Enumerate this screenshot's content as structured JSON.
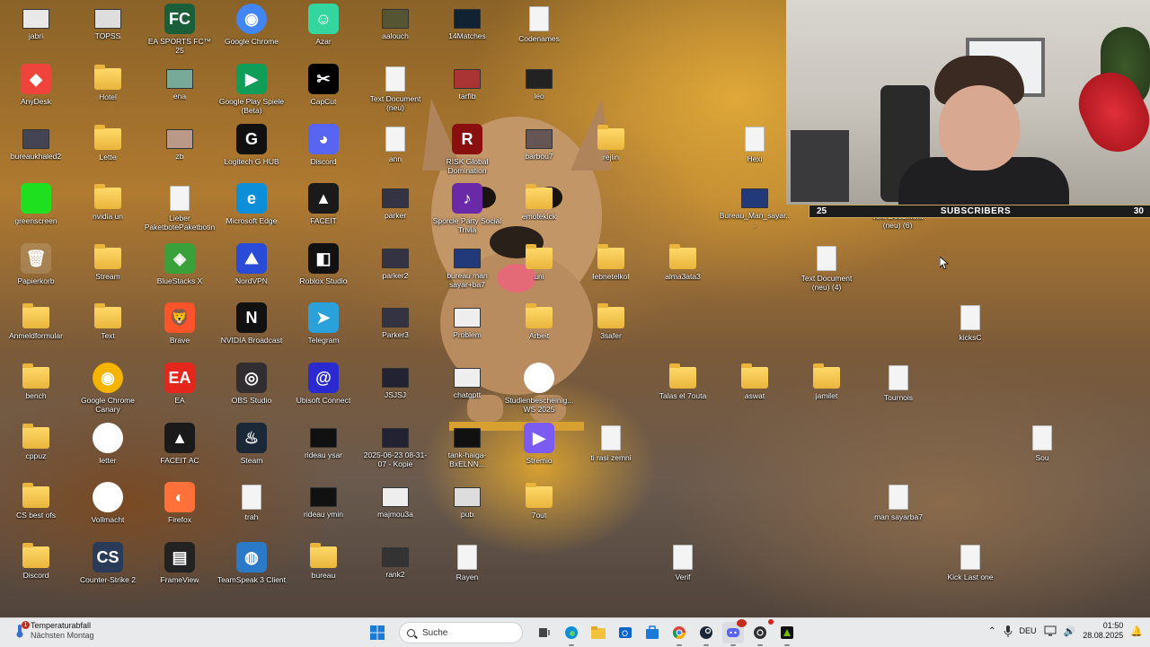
{
  "desktop": {
    "icons": [
      {
        "label": "jabri",
        "type": "thumb",
        "color": "#e8e8e8"
      },
      {
        "label": "TOPSS",
        "type": "thumb",
        "color": "#ddd"
      },
      {
        "label": "EA SPORTS FC™ 25",
        "type": "app",
        "color": "#1b5e3a",
        "glyph": "FC"
      },
      {
        "label": "Google Chrome",
        "type": "app",
        "color": "#4285f4",
        "glyph": "◉"
      },
      {
        "label": "Azar",
        "type": "app",
        "color": "#33d69f",
        "glyph": "☺"
      },
      {
        "label": "aalouch",
        "type": "thumb",
        "color": "#553"
      },
      {
        "label": "14Matches",
        "type": "thumb",
        "color": "#123"
      },
      {
        "label": "Codenames",
        "type": "doc"
      },
      {
        "label": "AnyDesk",
        "type": "app",
        "color": "#ef443b",
        "glyph": "◆"
      },
      {
        "label": "Hotel",
        "type": "folder"
      },
      {
        "label": "ena",
        "type": "thumb",
        "color": "#7a9"
      },
      {
        "label": "Google Play Spiele (Beta)",
        "type": "app",
        "color": "#0f9d58",
        "glyph": "▶"
      },
      {
        "label": "CapCut",
        "type": "app",
        "color": "#000",
        "glyph": "✂"
      },
      {
        "label": "Text Document (neu)",
        "type": "doc"
      },
      {
        "label": "tarfib",
        "type": "thumb",
        "color": "#a33"
      },
      {
        "label": "leo",
        "type": "thumb",
        "color": "#222"
      },
      {
        "label": "bureaukhaled2",
        "type": "thumb",
        "color": "#445"
      },
      {
        "label": "Lette",
        "type": "folder"
      },
      {
        "label": "zb",
        "type": "thumb",
        "color": "#b98"
      },
      {
        "label": "Logitech G HUB",
        "type": "app",
        "color": "#111",
        "glyph": "G"
      },
      {
        "label": "Discord",
        "type": "app",
        "color": "#5865f2",
        "glyph": "◕"
      },
      {
        "label": "ann",
        "type": "doc"
      },
      {
        "label": "RISK Global Domination",
        "type": "app",
        "color": "#8a1010",
        "glyph": "R"
      },
      {
        "label": "barbou7",
        "type": "thumb",
        "color": "#655"
      },
      {
        "label": "rejlin",
        "type": "folder"
      },
      {
        "label": "Hexi",
        "type": "doc"
      },
      {
        "label": "greenscreen",
        "type": "app",
        "color": "#1fe01f",
        "glyph": ""
      },
      {
        "label": "nvidia un",
        "type": "folder"
      },
      {
        "label": "Lieber PaketbotePaketbotin,",
        "type": "doc"
      },
      {
        "label": "Microsoft Edge",
        "type": "app",
        "color": "#0c8ed8",
        "glyph": "e"
      },
      {
        "label": "FACEIT",
        "type": "app",
        "color": "#1a1a1a",
        "glyph": "▲"
      },
      {
        "label": "parker",
        "type": "thumb",
        "color": "#334"
      },
      {
        "label": "Sporcle Party Social Trivia",
        "type": "app",
        "color": "#6a2aa8",
        "glyph": "♪"
      },
      {
        "label": "emotekick",
        "type": "folder"
      },
      {
        "label": "Bureau_Man_sayar...",
        "type": "thumb",
        "color": "#223a7a"
      },
      {
        "label": "Papierkorb",
        "type": "app",
        "color": "rgba(255,255,255,0.15)",
        "glyph": "🗑"
      },
      {
        "label": "Stream",
        "type": "folder"
      },
      {
        "label": "BlueStacks X",
        "type": "app",
        "color": "#3aa13a",
        "glyph": "◈"
      },
      {
        "label": "NordVPN",
        "type": "app",
        "color": "#2a4ad8",
        "glyph": "⛰"
      },
      {
        "label": "Roblox Studio",
        "type": "app",
        "color": "#111",
        "glyph": "◧"
      },
      {
        "label": "parker2",
        "type": "thumb",
        "color": "#334"
      },
      {
        "label": "bureau man sayar+ba7",
        "type": "thumb",
        "color": "#223a7a"
      },
      {
        "label": "uni",
        "type": "folder"
      },
      {
        "label": "lebnetelkol",
        "type": "folder"
      },
      {
        "label": "alma3ata3",
        "type": "folder"
      },
      {
        "label": "Text Document (neu) (4)",
        "type": "doc"
      },
      {
        "label": "Anmeldformular",
        "type": "folder"
      },
      {
        "label": "Text",
        "type": "folder"
      },
      {
        "label": "Brave",
        "type": "app",
        "color": "#fb542b",
        "glyph": "🦁"
      },
      {
        "label": "NVIDIA Broadcast",
        "type": "app",
        "color": "#111",
        "glyph": "N"
      },
      {
        "label": "Telegram",
        "type": "app",
        "color": "#2aa1da",
        "glyph": "➤"
      },
      {
        "label": "Parker3",
        "type": "thumb",
        "color": "#334"
      },
      {
        "label": "Problem",
        "type": "thumb",
        "color": "#eee"
      },
      {
        "label": "Arbeit",
        "type": "folder"
      },
      {
        "label": "3safer",
        "type": "folder"
      },
      {
        "label": "kicksC",
        "type": "doc"
      },
      {
        "label": "bench",
        "type": "folder"
      },
      {
        "label": "Google Chrome Canary",
        "type": "app",
        "color": "#f4b400",
        "glyph": "◉"
      },
      {
        "label": "EA",
        "type": "app",
        "color": "#e4261c",
        "glyph": "EA"
      },
      {
        "label": "OBS Studio",
        "type": "app",
        "color": "#302e31",
        "glyph": "◎"
      },
      {
        "label": "Ubisoft Connect",
        "type": "app",
        "color": "#2a2ad0",
        "glyph": "@"
      },
      {
        "label": "JSJSJ",
        "type": "thumb",
        "color": "#223"
      },
      {
        "label": "chatgptt",
        "type": "thumb",
        "color": "#eee"
      },
      {
        "label": "Studienbescheinig... WS 2025",
        "type": "app",
        "color": "#fff",
        "glyph": "◉"
      },
      {
        "label": "Talas el 7outa",
        "type": "folder"
      },
      {
        "label": "aswat",
        "type": "folder"
      },
      {
        "label": "jamilet",
        "type": "folder"
      },
      {
        "label": "Tournois",
        "type": "doc"
      },
      {
        "label": "cppuz",
        "type": "folder"
      },
      {
        "label": "letter",
        "type": "app",
        "color": "#fff",
        "glyph": "◉"
      },
      {
        "label": "FACEIT AC",
        "type": "app",
        "color": "#1a1a1a",
        "glyph": "▲"
      },
      {
        "label": "Steam",
        "type": "app",
        "color": "#1b2838",
        "glyph": "♨"
      },
      {
        "label": "rideau ysar",
        "type": "thumb",
        "color": "#111"
      },
      {
        "label": "2025-06-23 08-31-07 - Kopie",
        "type": "thumb",
        "color": "#223"
      },
      {
        "label": "tank-haiga-BxELNN...",
        "type": "thumb",
        "color": "#111"
      },
      {
        "label": "Stremio",
        "type": "app",
        "color": "#7b5bf2",
        "glyph": "▶"
      },
      {
        "label": "ti rasi zemni",
        "type": "doc"
      },
      {
        "label": "Sou",
        "type": "doc"
      },
      {
        "label": "CS best ofs",
        "type": "folder"
      },
      {
        "label": "Vollmacht",
        "type": "app",
        "color": "#fff",
        "glyph": "◉"
      },
      {
        "label": "Firefox",
        "type": "app",
        "color": "#ff7139",
        "glyph": "◐"
      },
      {
        "label": "trah",
        "type": "doc"
      },
      {
        "label": "rideau ymin",
        "type": "thumb",
        "color": "#111"
      },
      {
        "label": "majmou3a",
        "type": "thumb",
        "color": "#eee"
      },
      {
        "label": "pub",
        "type": "thumb",
        "color": "#ddd"
      },
      {
        "label": "7out",
        "type": "folder"
      },
      {
        "label": "man sayarba7",
        "type": "doc"
      },
      {
        "label": "Discord",
        "type": "folder"
      },
      {
        "label": "Counter-Strike 2",
        "type": "app",
        "color": "#2a3b5a",
        "glyph": "CS"
      },
      {
        "label": "FrameView",
        "type": "app",
        "color": "#222",
        "glyph": "▤"
      },
      {
        "label": "TeamSpeak 3 Client",
        "type": "app",
        "color": "#2a7ac8",
        "glyph": "◍"
      },
      {
        "label": "bureau",
        "type": "folder"
      },
      {
        "label": "rank2",
        "type": "thumb",
        "color": "#333"
      },
      {
        "label": "Rayen",
        "type": "doc"
      },
      {
        "label": "Verif",
        "type": "doc"
      },
      {
        "label": "Kick Last one",
        "type": "doc"
      }
    ],
    "overlap_label": "Text Document (neu) (6)"
  },
  "webcam_overlay": {
    "left_count": "25",
    "label": "SUBSCRIBERS",
    "right_count": "30"
  },
  "taskbar": {
    "weather": {
      "title": "Temperaturabfall",
      "subtitle": "Nächsten Montag",
      "badge": "1"
    },
    "search_placeholder": "Suche",
    "language": "DEU",
    "time": "01:50",
    "date": "28.08.2025"
  }
}
